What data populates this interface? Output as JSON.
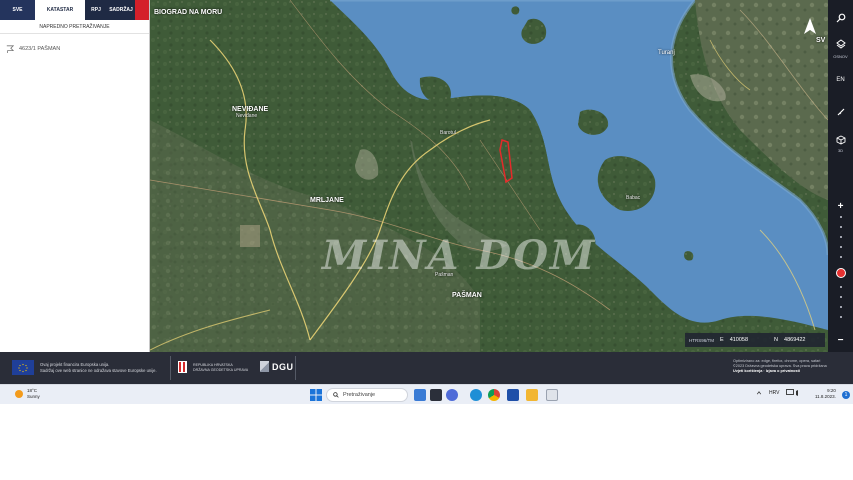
{
  "panel": {
    "tabs": [
      "SVE",
      "KATASTAR",
      "RPJ",
      "SADRŽAJ"
    ],
    "advanced_search": "NAPREDNO PRETRAŽIVANJE",
    "result": "4623/1 PAŠMAN"
  },
  "map": {
    "places": {
      "biograd": "BIOGRAD NA MORU",
      "turanj": "Turanj",
      "neviđane": "NEVIĐANE",
      "neviđane_small": "Neviđane",
      "barotul": "Barotul",
      "mrljane": "MRLJANE",
      "babac": "Babac",
      "pasman": "Pašman",
      "pasman_big": "PAŠMAN",
      "sv": "SV"
    },
    "watermark": "MINA DOM",
    "coords": {
      "crs": "HTRS96/TM",
      "e_label": "E",
      "e_value": "410058",
      "n_label": "N",
      "n_value": "4869422"
    }
  },
  "toolbar": {
    "osnov_label": "OSNOV",
    "en_label": "EN",
    "3d_label": "3D",
    "zoom_in": "+",
    "zoom_out": "−"
  },
  "footer": {
    "eu_text_1": "Ovaj projekt financira Europska unija.",
    "eu_text_2": "Sadržaj ove web stranice ne odražava stavove Europske unije.",
    "rh_text_1": "REPUBLIKA HRVATSKA",
    "rh_text_2": "DRŽAVNA GEODETSKA UPRAVA",
    "dgu": "DGU",
    "right_1": "Optimizirano za: edge, firefox, chrome, opera, safari",
    "right_2": "©2023 Državna geodetska uprava. Sva prava pridržana",
    "right_3": "Uvjeti korištenja · Izjava o privatnosti"
  },
  "taskbar": {
    "weather_temp": "18°C",
    "weather_desc": "Sunny",
    "search_placeholder": "Pretraživanje",
    "lang": "HRV",
    "time": "9:20",
    "date": "11.8.2023."
  },
  "colors": {
    "sea": "#5a8ec2",
    "land": "#3e5a37",
    "parcel": "#e52a2a",
    "border_line": "#f1d878",
    "tab_red": "#d4202a"
  }
}
